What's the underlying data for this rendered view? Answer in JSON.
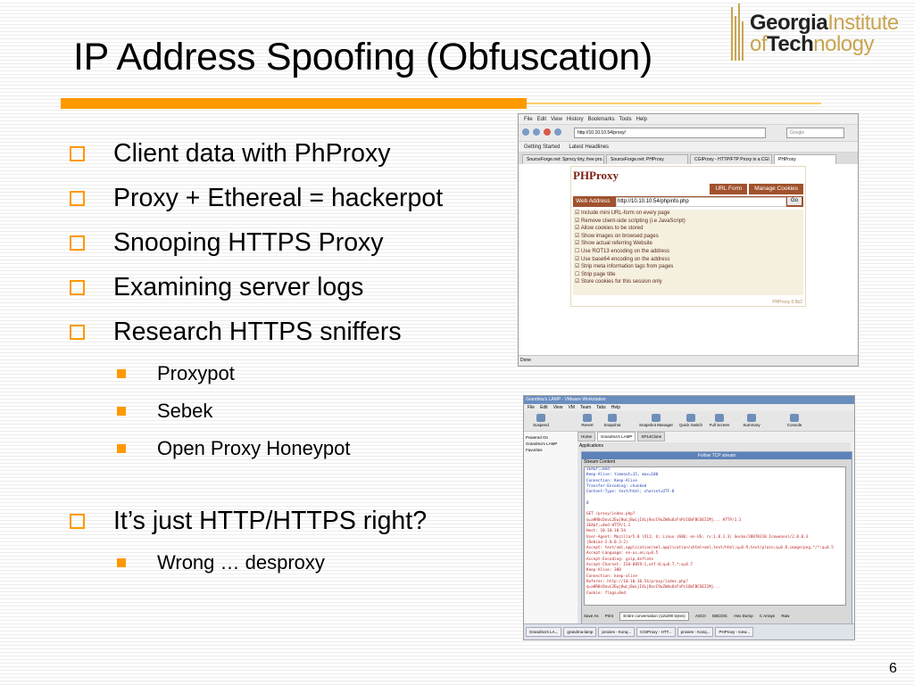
{
  "slide": {
    "title": "IP Address Spoofing (Obfuscation)",
    "page_number": "6",
    "logo": {
      "line1_bold": "Georgia",
      "line1_light": "Institute",
      "line2_pre": "of",
      "line2_bold": "Tech",
      "line2_light": "nology"
    },
    "bullets": [
      {
        "text": "Client data with PhProxy"
      },
      {
        "text": "Proxy + Ethereal = hackerpot"
      },
      {
        "text": "Snooping HTTPS Proxy"
      },
      {
        "text": "Examining server logs"
      },
      {
        "text": "Research HTTPS sniffers"
      }
    ],
    "sub_bullets": [
      {
        "text": "Proxypot"
      },
      {
        "text": "Sebek"
      },
      {
        "text": "Open Proxy Honeypot"
      }
    ],
    "bullet_last": {
      "text": "It’s just HTTP/HTTPS right?"
    },
    "sub_last": {
      "text": "Wrong … desproxy"
    },
    "colors": {
      "accent": "#ff9900",
      "accent_light": "#ffcc66"
    }
  },
  "screenshot1": {
    "menu": [
      "File",
      "Edit",
      "View",
      "History",
      "Bookmarks",
      "Tools",
      "Help"
    ],
    "url": "http://10.10.10.54/proxy/",
    "search_placeholder": "Google",
    "bookmarks": [
      "Getting Started",
      "Latest Headlines"
    ],
    "tabs": [
      "SourceForge.net: Sprocy tiny, free pro...",
      "SourceForge.net: PHProxy",
      "CGIProxy - HTTP/FTP Proxy in a CGI ...",
      "PHProxy"
    ],
    "phproxy": {
      "logo": "PHProxy",
      "tab_url_form": "URL Form",
      "tab_manage_cookies": "Manage Cookies",
      "address_label": "Web Address",
      "address_value": "http://10.10.10.54/phpinfo.php",
      "go_label": "Go",
      "options": [
        "☑ Include mini URL-form on every page",
        "☑ Remove client-side scripting (i.e JavaScript)",
        "☑ Allow cookies to be stored",
        "☑ Show images on browsed pages",
        "☑ Show actual referring Website",
        "☐ Use ROT13 encoding on the address",
        "☑ Use base64 encoding on the address",
        "☑ Strip meta information tags from pages",
        "☐ Strip page title",
        "☑ Store cookies for this session only"
      ],
      "version": "PHProxy 0.5b2"
    },
    "status": "Done"
  },
  "screenshot2": {
    "title": "Grandma's LAMP - VMware Workstation",
    "menu": [
      "File",
      "Edit",
      "View",
      "VM",
      "Team",
      "Tabs",
      "Help"
    ],
    "toolbar": [
      "Suspend",
      "Revert",
      "Snapshot",
      "Snapshot Manager",
      "Quick Switch",
      "Full Screen",
      "Summary",
      "Console"
    ],
    "sidebar": [
      "Powered On",
      "Grandma's LAMP",
      "Favorites"
    ],
    "vm_tabs": [
      "Home",
      "Grandma's LAMP",
      "XP14Clone"
    ],
    "applications": "Applications",
    "tcp_title": "Follow TCP stream",
    "stream_label": "Stream Content",
    "stream_lines": [
      {
        "text": "3EA&f;=8ed",
        "red": false
      },
      {
        "text": "Keep-Alive: timeout=15, max=100",
        "red": false
      },
      {
        "text": "Connection: Keep-Alive",
        "red": false
      },
      {
        "text": "Transfer-Encoding: chunked",
        "red": false
      },
      {
        "text": "Content-Type: text/html; charset=UTF-8",
        "red": false
      },
      {
        "text": "",
        "red": false
      },
      {
        "text": "0",
        "red": false
      },
      {
        "text": "",
        "red": false
      },
      {
        "text": "GET /proxy/index.php?",
        "red": true
      },
      {
        "text": "q=aHR0cDovL2Ewj8wLj8wLjI4Lj8ocC9uZWduUzFnPz1QbFBCOEI1Mj... HTTP/1.1",
        "red": true
      },
      {
        "text": "3EA&f;=8ed HTTP/1.1",
        "red": true
      },
      {
        "text": "Host: 10.10.10.54",
        "red": true
      },
      {
        "text": "User-Agent: Mozilla/5.0 (X11; U; Linux i686; en-US; rv:1.8.1.3) Gecko/20070310 Iceweasel/2.0.0.3",
        "red": true
      },
      {
        "text": "(Debian-2.0.0.3-2)",
        "red": true
      },
      {
        "text": "Accept: text/xml,application/xml,application/xhtml+xml,text/html;q=0.9,text/plain;q=0.8,image/png,*/*;q=0.5",
        "red": true
      },
      {
        "text": "Accept-Language: en-us,en;q=0.5",
        "red": true
      },
      {
        "text": "Accept-Encoding: gzip,deflate",
        "red": true
      },
      {
        "text": "Accept-Charset: ISO-8859-1,utf-8;q=0.7,*;q=0.7",
        "red": true
      },
      {
        "text": "Keep-Alive: 300",
        "red": true
      },
      {
        "text": "Connection: keep-alive",
        "red": true
      },
      {
        "text": "Referer: http://10.10.10.54/proxy/index.php?",
        "red": true
      },
      {
        "text": "q=aHR0cDovL2Ewj8wLj8wLjI4Lj8ocC9uZWduUzFnPz1QbFBCOEI1Mj...",
        "red": true
      },
      {
        "text": "Cookie: flags=8ed",
        "red": true
      }
    ],
    "save_as": "Save As",
    "print": "Print",
    "conversation": "Entire conversation (115290 bytes)",
    "formats": [
      "ASCII",
      "EBCDIC",
      "Hex Dump",
      "C Arrays",
      "Raw"
    ],
    "taskbar": [
      "Grandma's LA...",
      "grandma-lamp",
      "proxies - Konq...",
      "CGIProxy - HTT...",
      "proxies - Konq...",
      "PHProxy - Icew..."
    ]
  }
}
